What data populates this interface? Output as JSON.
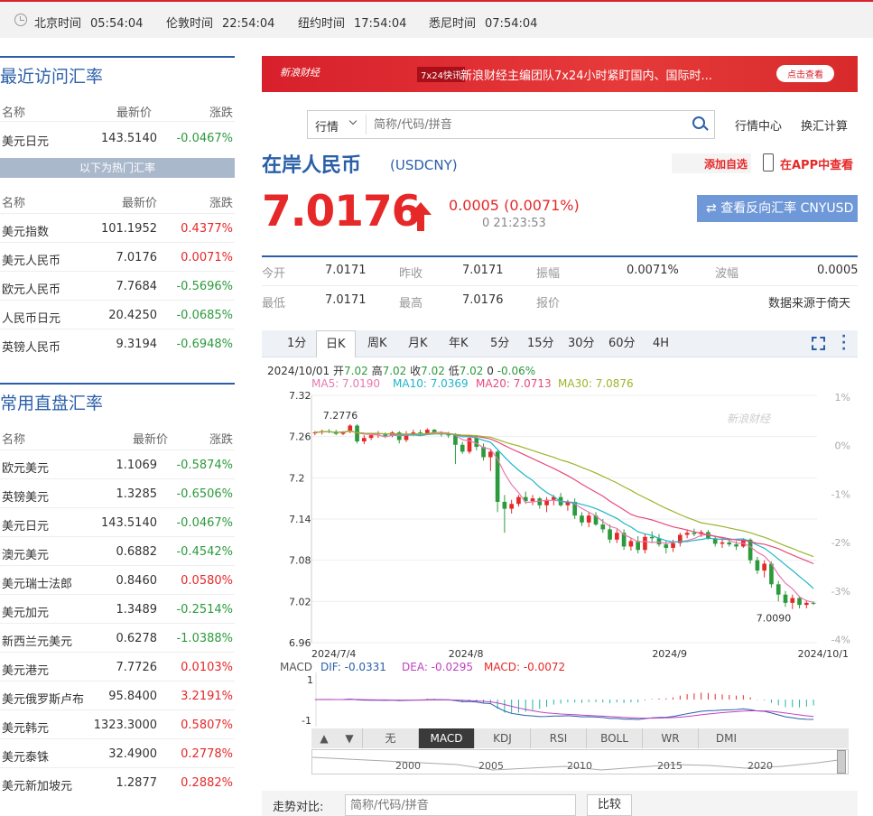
{
  "topbar": {
    "zones": [
      {
        "city": "北京时间",
        "time": "05:54:04"
      },
      {
        "city": "伦敦时间",
        "time": "22:54:04"
      },
      {
        "city": "纽约时间",
        "time": "17:54:04"
      },
      {
        "city": "悉尼时间",
        "time": "07:54:04"
      }
    ]
  },
  "recent": {
    "title": "最近访问汇率",
    "headers": [
      "名称",
      "最新价",
      "涨跌"
    ],
    "rows": [
      {
        "name": "美元日元",
        "price": "143.5140",
        "change": "-0.0467%",
        "dir": "down"
      }
    ]
  },
  "hot": {
    "label": "以下为热门汇率",
    "headers": [
      "名称",
      "最新价",
      "涨跌"
    ],
    "rows": [
      {
        "name": "美元指数",
        "price": "101.1952",
        "change": "0.4377%",
        "dir": "up"
      },
      {
        "name": "美元人民币",
        "price": "7.0176",
        "change": "0.0071%",
        "dir": "up"
      },
      {
        "name": "欧元人民币",
        "price": "7.7684",
        "change": "-0.5696%",
        "dir": "down"
      },
      {
        "name": "人民币日元",
        "price": "20.4250",
        "change": "-0.0685%",
        "dir": "down"
      },
      {
        "name": "英镑人民币",
        "price": "9.3194",
        "change": "-0.6948%",
        "dir": "down"
      }
    ]
  },
  "cross": {
    "title": "常用直盘汇率",
    "headers": [
      "名称",
      "最新价",
      "涨跌"
    ],
    "rows": [
      {
        "name": "欧元美元",
        "price": "1.1069",
        "change": "-0.5874%",
        "dir": "down"
      },
      {
        "name": "英镑美元",
        "price": "1.3285",
        "change": "-0.6506%",
        "dir": "down"
      },
      {
        "name": "美元日元",
        "price": "143.5140",
        "change": "-0.0467%",
        "dir": "down"
      },
      {
        "name": "澳元美元",
        "price": "0.6882",
        "change": "-0.4542%",
        "dir": "down"
      },
      {
        "name": "美元瑞士法郎",
        "price": "0.8460",
        "change": "0.0580%",
        "dir": "up"
      },
      {
        "name": "美元加元",
        "price": "1.3489",
        "change": "-0.2514%",
        "dir": "down"
      },
      {
        "name": "新西兰元美元",
        "price": "0.6278",
        "change": "-1.0388%",
        "dir": "down"
      },
      {
        "name": "美元港元",
        "price": "7.7726",
        "change": "0.0103%",
        "dir": "up"
      },
      {
        "name": "美元俄罗斯卢布",
        "price": "95.8400",
        "change": "3.2191%",
        "dir": "up"
      },
      {
        "name": "美元韩元",
        "price": "1323.3000",
        "change": "0.5807%",
        "dir": "up"
      },
      {
        "name": "美元泰铢",
        "price": "32.4900",
        "change": "0.2778%",
        "dir": "up"
      },
      {
        "name": "美元新加坡元",
        "price": "1.2877",
        "change": "0.2882%",
        "dir": "up"
      }
    ]
  },
  "banner": {
    "logo": "新浪财经",
    "tag": "7x24快讯",
    "text": "新浪财经主编团队7x24小时紧盯国内、国际时...",
    "button": "点击查看"
  },
  "search": {
    "select": "行情",
    "placeholder": "简称/代码/拼音"
  },
  "links": {
    "center": "行情中心",
    "calc": "换汇计算"
  },
  "quote": {
    "name": "在岸人民币",
    "code": "(USDCNY)",
    "add": "添加自选",
    "app": "在APP中查看",
    "price": "7.0176",
    "change": "0.0005 (0.0071%)",
    "time": "0 21:23:53",
    "reverse": "查看反向汇率 CNYUSD"
  },
  "stats": {
    "row1": [
      {
        "label": "今开",
        "value": "7.0171"
      },
      {
        "label": "昨收",
        "value": "7.0171"
      },
      {
        "label": "振幅",
        "value": "0.0071%"
      },
      {
        "label": "波幅",
        "value": "0.0005"
      }
    ],
    "row2": [
      {
        "label": "最低",
        "value": "7.0171"
      },
      {
        "label": "最高",
        "value": "7.0176"
      },
      {
        "label": "报价",
        "value": "数据来源于倚天"
      }
    ]
  },
  "tabs": [
    "1分",
    "日K",
    "周K",
    "月K",
    "年K",
    "5分",
    "15分",
    "30分",
    "60分",
    "4H"
  ],
  "ohlc": {
    "date": "2024/10/01",
    "o_l": "开",
    "o": "7.02",
    "h_l": "高",
    "h": "7.02",
    "c_l": "收",
    "c": "7.02",
    "l_l": "低",
    "l": "7.02",
    "v": "0",
    "pct": "-0.06%"
  },
  "ma_labels": [
    {
      "text": "MA5: 7.0190",
      "color": "#e878b0"
    },
    {
      "text": "MA10: 7.0369",
      "color": "#20b5c8"
    },
    {
      "text": "MA20: 7.0713",
      "color": "#e64a7a"
    },
    {
      "text": "MA30: 7.0876",
      "color": "#9bb52a"
    }
  ],
  "macd_labels": {
    "name": "MACD",
    "dif": "DIF: -0.0331",
    "dea": "DEA: -0.0295",
    "macd": "MACD: -0.0072"
  },
  "indicators": [
    "无",
    "MACD",
    "KDJ",
    "RSI",
    "BOLL",
    "WR",
    "DMI"
  ],
  "nav_years": [
    "2000",
    "2005",
    "2010",
    "2015",
    "2020"
  ],
  "compare": {
    "label": "走势对比:",
    "placeholder": "简称/代码/拼音",
    "button": "比较"
  },
  "chart_data": {
    "type": "candlestick",
    "y_ticks": [
      "7.32",
      "7.26",
      "7.2",
      "7.14",
      "7.08",
      "7.02",
      "6.96"
    ],
    "ylim": [
      6.96,
      7.32
    ],
    "pct_ticks": [
      "1%",
      "0%",
      "-1%",
      "-2%",
      "-3%",
      "-4%"
    ],
    "x_ticks": [
      "2024/7/4",
      "2024/8",
      "2024/9",
      "2024/10/1"
    ],
    "annotations": [
      "7.2776",
      "7.0090"
    ],
    "watermark": "新浪财经",
    "colors": {
      "up": "#e62828",
      "down": "#2c9a3c"
    },
    "candles": [
      [
        7.265,
        7.268,
        7.262,
        7.266
      ],
      [
        7.266,
        7.27,
        7.263,
        7.268
      ],
      [
        7.268,
        7.271,
        7.265,
        7.267
      ],
      [
        7.267,
        7.27,
        7.262,
        7.264
      ],
      [
        7.264,
        7.268,
        7.262,
        7.267
      ],
      [
        7.267,
        7.278,
        7.265,
        7.276
      ],
      [
        7.276,
        7.278,
        7.25,
        7.253
      ],
      [
        7.253,
        7.262,
        7.249,
        7.258
      ],
      [
        7.258,
        7.264,
        7.255,
        7.262
      ],
      [
        7.262,
        7.268,
        7.258,
        7.263
      ],
      [
        7.263,
        7.266,
        7.258,
        7.261
      ],
      [
        7.261,
        7.268,
        7.259,
        7.266
      ],
      [
        7.266,
        7.268,
        7.25,
        7.255
      ],
      [
        7.255,
        7.268,
        7.252,
        7.264
      ],
      [
        7.264,
        7.27,
        7.261,
        7.266
      ],
      [
        7.266,
        7.27,
        7.262,
        7.265
      ],
      [
        7.265,
        7.272,
        7.263,
        7.27
      ],
      [
        7.27,
        7.271,
        7.264,
        7.266
      ],
      [
        7.266,
        7.268,
        7.26,
        7.263
      ],
      [
        7.263,
        7.267,
        7.258,
        7.262
      ],
      [
        7.262,
        7.265,
        7.22,
        7.248
      ],
      [
        7.248,
        7.252,
        7.235,
        7.238
      ],
      [
        7.238,
        7.262,
        7.235,
        7.258
      ],
      [
        7.258,
        7.262,
        7.24,
        7.245
      ],
      [
        7.245,
        7.25,
        7.225,
        7.23
      ],
      [
        7.23,
        7.242,
        7.21,
        7.238
      ],
      [
        7.238,
        7.24,
        7.15,
        7.165
      ],
      [
        7.165,
        7.175,
        7.12,
        7.155
      ],
      [
        7.155,
        7.168,
        7.148,
        7.162
      ],
      [
        7.162,
        7.175,
        7.158,
        7.172
      ],
      [
        7.172,
        7.18,
        7.162,
        7.166
      ],
      [
        7.166,
        7.175,
        7.16,
        7.17
      ],
      [
        7.17,
        7.172,
        7.155,
        7.16
      ],
      [
        7.16,
        7.172,
        7.15,
        7.168
      ],
      [
        7.168,
        7.175,
        7.16,
        7.172
      ],
      [
        7.172,
        7.178,
        7.158,
        7.16
      ],
      [
        7.16,
        7.168,
        7.152,
        7.165
      ],
      [
        7.165,
        7.17,
        7.14,
        7.145
      ],
      [
        7.145,
        7.15,
        7.13,
        7.135
      ],
      [
        7.135,
        7.15,
        7.128,
        7.145
      ],
      [
        7.145,
        7.15,
        7.13,
        7.132
      ],
      [
        7.132,
        7.14,
        7.12,
        7.125
      ],
      [
        7.125,
        7.132,
        7.105,
        7.11
      ],
      [
        7.11,
        7.125,
        7.105,
        7.12
      ],
      [
        7.12,
        7.125,
        7.095,
        7.1
      ],
      [
        7.1,
        7.112,
        7.094,
        7.108
      ],
      [
        7.108,
        7.115,
        7.09,
        7.095
      ],
      [
        7.095,
        7.118,
        7.09,
        7.114
      ],
      [
        7.114,
        7.122,
        7.105,
        7.112
      ],
      [
        7.112,
        7.118,
        7.1,
        7.103
      ],
      [
        7.103,
        7.108,
        7.09,
        7.098
      ],
      [
        7.098,
        7.11,
        7.092,
        7.105
      ],
      [
        7.105,
        7.12,
        7.1,
        7.117
      ],
      [
        7.117,
        7.124,
        7.112,
        7.12
      ],
      [
        7.12,
        7.126,
        7.115,
        7.118
      ],
      [
        7.118,
        7.124,
        7.114,
        7.121
      ],
      [
        7.121,
        7.124,
        7.11,
        7.112
      ],
      [
        7.112,
        7.116,
        7.1,
        7.104
      ],
      [
        7.104,
        7.11,
        7.098,
        7.106
      ],
      [
        7.106,
        7.112,
        7.1,
        7.103
      ],
      [
        7.103,
        7.108,
        7.095,
        7.1
      ],
      [
        7.1,
        7.112,
        7.098,
        7.11
      ],
      [
        7.11,
        7.112,
        7.075,
        7.08
      ],
      [
        7.08,
        7.085,
        7.06,
        7.065
      ],
      [
        7.065,
        7.08,
        7.055,
        7.075
      ],
      [
        7.075,
        7.078,
        7.04,
        7.045
      ],
      [
        7.045,
        7.05,
        7.02,
        7.03
      ],
      [
        7.03,
        7.035,
        7.012,
        7.018
      ],
      [
        7.018,
        7.03,
        7.009,
        7.025
      ],
      [
        7.025,
        7.028,
        7.01,
        7.015
      ],
      [
        7.015,
        7.022,
        7.01,
        7.018
      ],
      [
        7.018,
        7.02,
        7.015,
        7.017
      ]
    ]
  }
}
